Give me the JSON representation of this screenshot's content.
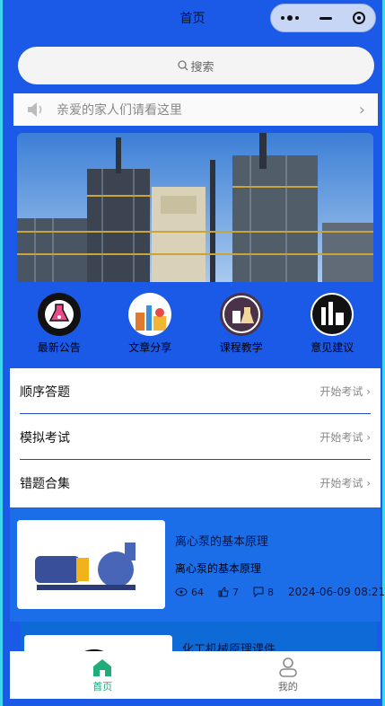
{
  "nav": {
    "title": "首页"
  },
  "search": {
    "placeholder": "搜索"
  },
  "notice": {
    "text": "亲爱的家人们请看这里"
  },
  "categories": [
    {
      "label": "最新公告",
      "icon": "flask-gear-icon"
    },
    {
      "label": "文章分享",
      "icon": "factory-icon"
    },
    {
      "label": "课程教学",
      "icon": "beakers-icon"
    },
    {
      "label": "意见建议",
      "icon": "lab-equipment-icon"
    }
  ],
  "quiz": [
    {
      "name": "顺序答题",
      "action": "开始考试"
    },
    {
      "name": "模拟考试",
      "action": "开始考试"
    },
    {
      "name": "错题合集",
      "action": "开始考试"
    }
  ],
  "articles": [
    {
      "title": "离心泵的基本原理",
      "subtitle": "离心泵的基本原理",
      "views": "64",
      "likes": "7",
      "comments": "8",
      "date": "2024-06-09 08:21"
    },
    {
      "title": "化工机械原理课件"
    }
  ],
  "tabbar": [
    {
      "label": "首页",
      "active": true
    },
    {
      "label": "我的",
      "active": false
    }
  ],
  "colors": {
    "primary_bg": "#1a5ae6",
    "active_tab": "#1fae7a",
    "border_accent": "#3fd6ef"
  }
}
